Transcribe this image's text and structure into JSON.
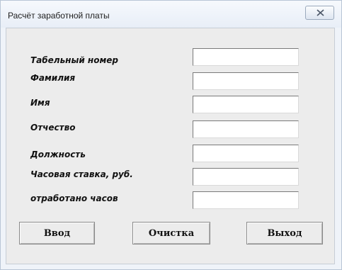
{
  "window": {
    "title": "Расчёт заработной платы",
    "close_icon": "close-icon"
  },
  "form": {
    "fields": [
      {
        "label": "Табельный номер",
        "value": ""
      },
      {
        "label": "Фамилия",
        "value": ""
      },
      {
        "label": "Имя",
        "value": ""
      },
      {
        "label": "Отчество",
        "value": ""
      },
      {
        "label": "Должность",
        "value": ""
      },
      {
        "label": "Часовая ставка, руб.",
        "value": ""
      },
      {
        "label": "отработано часов",
        "value": ""
      }
    ]
  },
  "buttons": {
    "enter": "Ввод",
    "clear": "Очистка",
    "exit": "Выход"
  }
}
